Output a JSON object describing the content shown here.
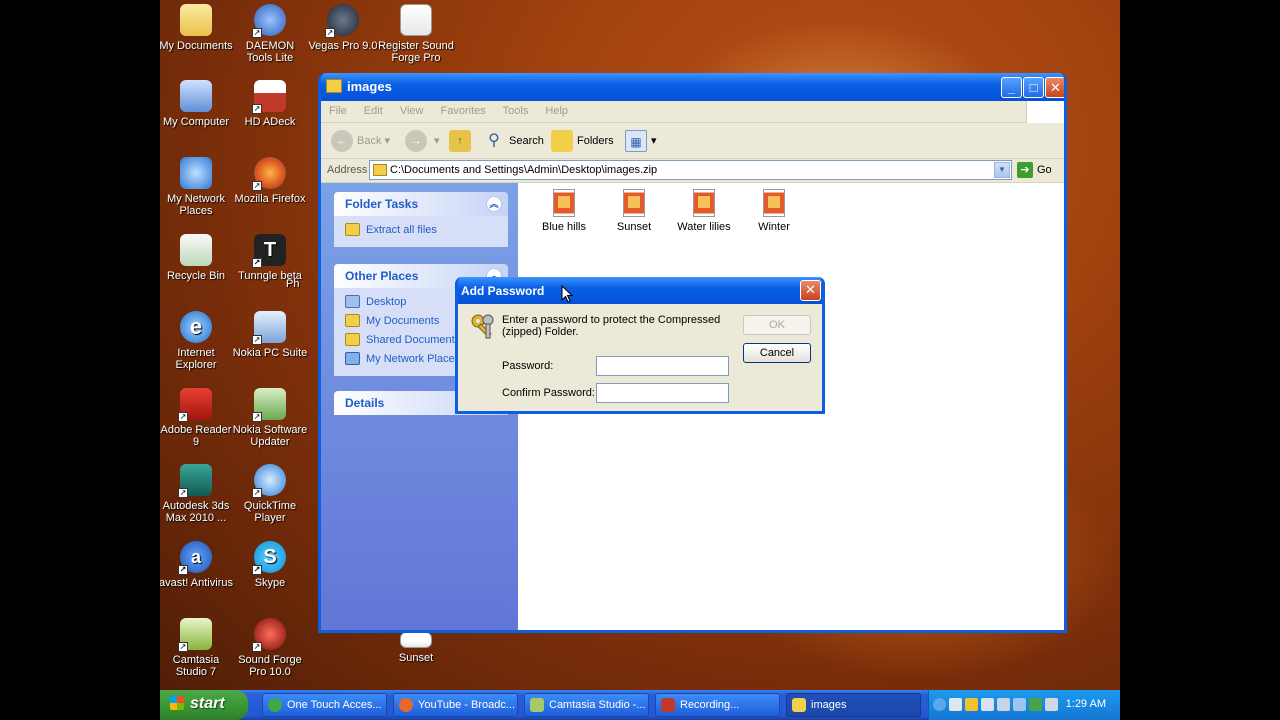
{
  "desktop": {
    "icons": [
      {
        "label": "My Documents"
      },
      {
        "label": "DAEMON Tools Lite"
      },
      {
        "label": "Vegas Pro 9.0"
      },
      {
        "label": "Register Sound Forge Pro"
      },
      {
        "label": "My Computer"
      },
      {
        "label": "HD ADeck"
      },
      {
        "label": "My Network Places"
      },
      {
        "label": "Mozilla Firefox"
      },
      {
        "label": "Recycle Bin"
      },
      {
        "label": "Tunngle beta"
      },
      {
        "label": "Internet Explorer"
      },
      {
        "label": "Nokia PC Suite"
      },
      {
        "label": "Adobe Reader 9"
      },
      {
        "label": "Nokia Software Updater"
      },
      {
        "label": "Autodesk 3ds Max 2010 ..."
      },
      {
        "label": "QuickTime Player"
      },
      {
        "label": "avast! Antivirus"
      },
      {
        "label": "Skype"
      },
      {
        "label": "Camtasia Studio 7"
      },
      {
        "label": "Sound Forge Pro 10.0"
      },
      {
        "label": "Sunset"
      }
    ],
    "partial_label": "Ph"
  },
  "window": {
    "title": "images",
    "menu": [
      "File",
      "Edit",
      "View",
      "Favorites",
      "Tools",
      "Help"
    ],
    "toolbar": {
      "back": "Back",
      "search": "Search",
      "folders": "Folders"
    },
    "address": {
      "label": "Address",
      "path": "C:\\Documents and Settings\\Admin\\Desktop\\images.zip",
      "go": "Go"
    },
    "folder_tasks": {
      "title": "Folder Tasks",
      "items": [
        "Extract all files"
      ]
    },
    "other_places": {
      "title": "Other Places",
      "items": [
        "Desktop",
        "My Documents",
        "Shared Documents",
        "My Network Places"
      ]
    },
    "details": {
      "title": "Details"
    },
    "files": [
      "Blue hills",
      "Sunset",
      "Water lilies",
      "Winter"
    ]
  },
  "dialog": {
    "title": "Add Password",
    "message": "Enter a password to protect the Compressed (zipped) Folder.",
    "password_label": "Password:",
    "confirm_label": "Confirm Password:",
    "ok": "OK",
    "cancel": "Cancel"
  },
  "taskbar": {
    "start": "start",
    "tasks": [
      "One Touch Acces...",
      "YouTube - Broadc...",
      "Camtasia Studio -...",
      "Recording...",
      "images"
    ],
    "clock": "1:29 AM"
  }
}
